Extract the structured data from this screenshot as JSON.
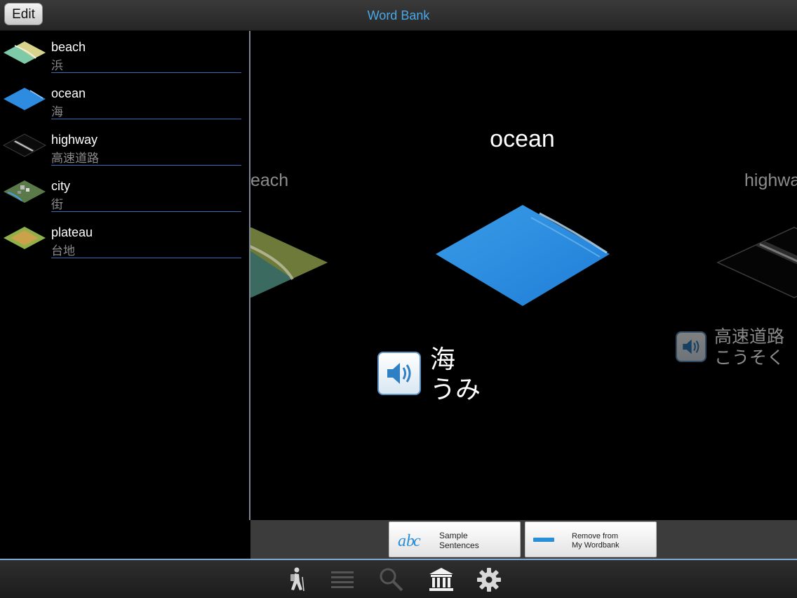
{
  "header": {
    "edit_label": "Edit",
    "title": "Word Bank"
  },
  "sidebar": {
    "items": [
      {
        "en": "beach",
        "jp": "浜",
        "thumb": "beach-icon"
      },
      {
        "en": "ocean",
        "jp": "海",
        "thumb": "ocean-icon"
      },
      {
        "en": "highway",
        "jp": "高速道路",
        "thumb": "highway-icon"
      },
      {
        "en": "city",
        "jp": "街",
        "thumb": "city-icon"
      },
      {
        "en": "plateau",
        "jp": "台地",
        "thumb": "plateau-icon"
      }
    ]
  },
  "stage": {
    "prev": {
      "title": "each"
    },
    "current": {
      "title": "ocean",
      "kanji": "海",
      "kana": "うみ"
    },
    "next": {
      "title": "highwa",
      "kanji": "高速道路",
      "kana": "こうそく"
    }
  },
  "actions": {
    "sample_line1": "Sample",
    "sample_line2": "Sentences",
    "remove_line1": "Remove from",
    "remove_line2": "My Wordbank"
  },
  "tabs": [
    "hiker-icon",
    "list-icon",
    "magnifier-icon",
    "museum-icon",
    "gear-icon"
  ],
  "colors": {
    "accent": "#4aa8e8",
    "ocean": "#2d8be0",
    "divider": "#3b6fb5"
  }
}
